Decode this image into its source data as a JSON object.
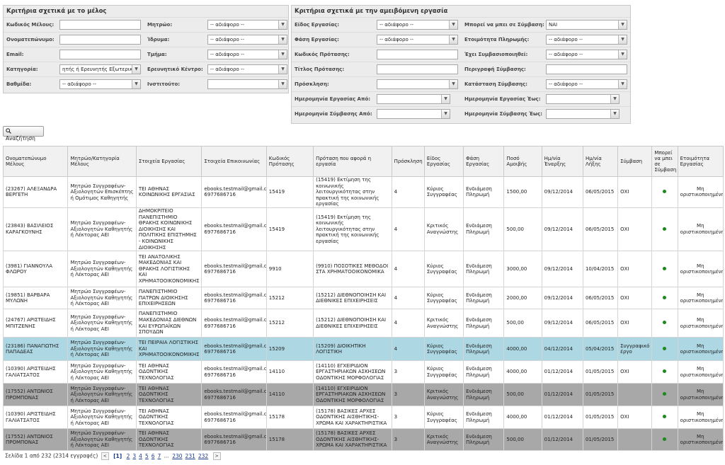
{
  "left_panel": {
    "title": "Κριτήρια σχετικά με το μέλος",
    "fields": [
      {
        "label": "Κωδικός Μέλους:",
        "type": "input",
        "value": ""
      },
      {
        "label": "Μητρώο:",
        "type": "select",
        "value": "-- αδιάφορο --"
      },
      {
        "label": "Ονοματεπώνυμο:",
        "type": "input",
        "value": ""
      },
      {
        "label": "Ίδρυμα:",
        "type": "select",
        "value": "-- αδιάφορο --"
      },
      {
        "label": "Email:",
        "type": "input",
        "value": ""
      },
      {
        "label": "Τμήμα:",
        "type": "select",
        "value": "-- αδιάφορο --"
      },
      {
        "label": "Κατηγορία:",
        "type": "select",
        "value": "ητής ή Ερευνητής Εξωτερικου"
      },
      {
        "label": "Ερευνητικό Κέντρο:",
        "type": "select",
        "value": "-- αδιάφορο --"
      },
      {
        "label": "Βαθμίδα:",
        "type": "select",
        "value": "-- αδιάφορο --"
      },
      {
        "label": "Ινστιτούτο:",
        "type": "select",
        "value": ""
      }
    ]
  },
  "right_panel": {
    "title": "Κριτήρια σχετικά με την αμειβόμενη εργασία",
    "fields": [
      {
        "label": "Είδος Εργασίας:",
        "type": "select",
        "value": "-- αδιάφορο --"
      },
      {
        "label": "Μπορεί να μπει σε Σύμβαση:",
        "type": "select",
        "value": "ΝΑΙ"
      },
      {
        "label": "Φάση Εργασίας:",
        "type": "select",
        "value": "-- αδιάφορο --"
      },
      {
        "label": "Ετοιμότητα Πληρωμής:",
        "type": "select",
        "value": "-- αδιάφορο --"
      },
      {
        "label": "Κωδικός Πρότασης:",
        "type": "input",
        "value": ""
      },
      {
        "label": "Έχει Συμβασιοποιηθεί:",
        "type": "select",
        "value": "-- αδιάφορο --"
      },
      {
        "label": "Τίτλος Πρότασης:",
        "type": "input",
        "value": ""
      },
      {
        "label": "Περιγραφή Σύμβασης:",
        "type": "input",
        "value": ""
      },
      {
        "label": "Πρόσκληση:",
        "type": "select",
        "value": ""
      },
      {
        "label": "Κατάσταση Σύμβασης:",
        "type": "select",
        "value": "-- αδιάφορο --"
      },
      {
        "label": "Ημερομηνία Εργασίας Από:",
        "type": "select",
        "value": ""
      },
      {
        "label": "Ημερομηνία Εργασίας Έως:",
        "type": "select",
        "value": ""
      },
      {
        "label": "Ημερομηνία Σύμβασης Από:",
        "type": "select",
        "value": ""
      },
      {
        "label": "Ημερομηνία Σύμβασης Έως:",
        "type": "select",
        "value": ""
      }
    ]
  },
  "search_button": {
    "label": "Αναζήτηση",
    "icon": "magnifier-icon"
  },
  "table": {
    "columns": [
      "Ονοματεπώνυμο Μέλους",
      "Μητρώο/Κατηγορία Μέλους",
      "Στοιχεία Εργασίας",
      "Στοιχεία Επικοινωνίας",
      "Κωδικός Πρότασης",
      "Πρόταση που αφορά η εργασία",
      "Πρόσκληση",
      "Είδος Εργασίας",
      "Φάση Εργασίας",
      "Ποσό Αμοιβής",
      "Ημ/νία Έναρξης",
      "Ημ/νία Λήξης",
      "Σύμβαση",
      "Μπορεί να μπει σε Σύμβαση",
      "Ετοιμότητα Εργασίας"
    ],
    "rows": [
      {
        "style": "white",
        "cells": [
          "(23267) ΑΛΕΞΑΝΔΡΑ ΒΕΡΓΕΤΗ",
          "Μητρώο Συγγραφέων-Αξιολογητών Επισκέπτης ή Ομότιμος Καθηγητής",
          "ΤΕΙ ΑΘΗΝΑΣ ΚΟΙΝΩΝΙΚΗΣ ΕΡΓΑΣΙΑΣ",
          "ebooks.testmail@gmail.com 6977686716",
          "15419",
          "(15419) Εκτίμηση της κοινωνικής λειτουργικότητας στην πρακτική της κοινωνικής εργασίας",
          "4",
          "Κύριος Συγγραφέας",
          "Ενδιάμεση Πληρωμή",
          "1500,00",
          "09/12/2014",
          "06/05/2015",
          "ΟΧΙ",
          "●",
          "Μη οριστικοποιημένη"
        ]
      },
      {
        "style": "white",
        "cells": [
          "(23843) ΒΑΣΙΛΕΙΟΣ ΚΑΡΑΓΚΟΥΝΗΣ",
          "Μητρώο Συγγραφέων-Αξιολογητών Καθηγητής ή Λέκτορας ΑΕΙ",
          "ΔΗΜΟΚΡΙΤΕΙΟ ΠΑΝΕΠΙΣΤΗΜΙΟ ΘΡΑΚΗΣ ΚΟΙΝΩΝΙΚΗΣ ΔΙΟΙΚΗΣΗΣ ΚΑΙ ΠΟΛΙΤΙΚΗΣ ΕΠΙΣΤΗΜΗΣ - ΚΟΙΝΩΝΙΚΗΣ ΔΙΟΙΚΗΣΗΣ",
          "ebooks.testmail@gmail.com 6977686716",
          "15419",
          "(15419) Εκτίμηση της κοινωνικής λειτουργικότητας στην πρακτική της κοινωνικής εργασίας",
          "4",
          "Κριτικός Αναγνώστης",
          "Ενδιάμεση Πληρωμή",
          "500,00",
          "09/12/2014",
          "06/05/2015",
          "ΟΧΙ",
          "●",
          "Μη οριστικοποιημένη"
        ]
      },
      {
        "style": "white",
        "cells": [
          "(3981) ΓΙΑΝΝΟΥΛΑ ΦΛΩΡΟΥ",
          "Μητρώο Συγγραφέων-Αξιολογητών Καθηγητής ή Λέκτορας ΑΕΙ",
          "ΤΕΙ ΑΝΑΤΟΛΙΚΗΣ ΜΑΚΕΔΟΝΙΑΣ ΚΑΙ ΘΡΑΚΗΣ ΛΟΓΙΣΤΙΚΗΣ ΚΑΙ ΧΡΗΜΑΤΟΟΙΚΟΝΟΜΙΚΗΣ",
          "ebooks.testmail@gmail.com 6977686716",
          "9910",
          "(9910) ΠΟΣΟΤΙΚΕΣ ΜΕΘΟΔΟΙ ΣΤΑ ΧΡΗΜΑΤΟΟΙΚΟΝΟΜΙΚΑ",
          "4",
          "Κύριος Συγγραφέας",
          "Ενδιάμεση Πληρωμή",
          "3000,00",
          "09/12/2014",
          "10/04/2015",
          "ΟΧΙ",
          "●",
          "Μη οριστικοποιημένη"
        ]
      },
      {
        "style": "white",
        "cells": [
          "(19851) ΒΑΡΒΑΡΑ ΜΥΛΩΝΗ",
          "Μητρώο Συγγραφέων-Αξιολογητών Καθηγητής ή Λέκτορας ΑΕΙ",
          "ΠΑΝΕΠΙΣΤΗΜΙΟ ΠΑΤΡΩΝ ΔΙΟΙΚΗΣΗΣ ΕΠΙΧΕΙΡΗΣΕΩΝ",
          "ebooks.testmail@gmail.com 6977686716",
          "15212",
          "(15212) ΔΙΕΘΝΟΠΟΙΗΣΗ ΚΑΙ ΔΙΕΘΝΙΚΕΣ ΕΠΙΧΕΙΡΗΣΕΙΣ",
          "4",
          "Κύριος Συγγραφέας",
          "Ενδιάμεση Πληρωμή",
          "2000,00",
          "09/12/2014",
          "06/05/2015",
          "ΟΧΙ",
          "●",
          "Μη οριστικοποιημένη"
        ]
      },
      {
        "style": "white",
        "cells": [
          "(24767) ΑΡΙΣΤΕΙΔΗΣ ΜΠΙΤΖΕΝΗΣ",
          "Μητρώο Συγγραφέων-Αξιολογητών Καθηγητής ή Λέκτορας ΑΕΙ",
          "ΠΑΝΕΠΙΣΤΗΜΙΟ ΜΑΚΕΔΟΝΙΑΣ ΔΙΕΘΝΩΝ ΚΑΙ ΕΥΡΩΠΑΪΚΩΝ ΣΠΟΥΔΩΝ",
          "ebooks.testmail@gmail.com 6977686716",
          "15212",
          "(15212) ΔΙΕΘΝΟΠΟΙΗΣΗ ΚΑΙ ΔΙΕΘΝΙΚΕΣ ΕΠΙΧΕΙΡΗΣΕΙΣ",
          "4",
          "Κριτικός Αναγνώστης",
          "Ενδιάμεση Πληρωμή",
          "500,00",
          "09/12/2014",
          "06/05/2015",
          "ΟΧΙ",
          "●",
          "Μη οριστικοποιημένη"
        ]
      },
      {
        "style": "sel",
        "cells": [
          "(23186) ΠΑΝΑΓΙΩΤΗΣ ΠΑΠΑΔΕΑΣ",
          "Μητρώο Συγγραφέων-Αξιολογητών Καθηγητής ή Λέκτορας ΑΕΙ",
          "ΤΕΙ ΠΕΙΡΑΙΑ ΛΟΓΙΣΤΙΚΗΣ ΚΑΙ ΧΡΗΜΑΤΟΟΙΚΟΝΟΜΙΚΗΣ",
          "ebooks.testmail@gmail.com 6977686716",
          "15209",
          "(15209) ΔΙΟΙΚΗΤΙΚΗ ΛΟΓΙΣΤΙΚΗ",
          "4",
          "Κύριος Συγγραφέας",
          "Ενδιάμεση Πληρωμή",
          "4000,00",
          "04/12/2014",
          "05/04/2015",
          "Συγγραφικό έργο",
          "●",
          "Μη οριστικοποιημένη"
        ]
      },
      {
        "style": "white",
        "cells": [
          "(10390) ΑΡΙΣΤΕΙΔΗΣ ΓΑΛΙΑΤΣΑΤΟΣ",
          "Μητρώο Συγγραφέων-Αξιολογητών Καθηγητής ή Λέκτορας ΑΕΙ",
          "ΤΕΙ ΑΘΗΝΑΣ ΟΔΟΝΤΙΚΗΣ ΤΕΧΝΟΛΟΓΙΑΣ",
          "ebooks.testmail@gmail.com 6977686716",
          "14110",
          "(14110) ΕΓΧΕΙΡΙΔΙΟΝ ΕΡΓΑΣΤΗΡΙΑΚΩΝ ΑΣΚΗΣΕΩΝ ΟΔΟΝΤΙΚΗΣ ΜΟΡΦΟΛΟΓΙΑΣ",
          "3",
          "Κύριος Συγγραφέας",
          "Ενδιάμεση Πληρωμή",
          "4000,00",
          "01/12/2014",
          "01/05/2015",
          "ΟΧΙ",
          "●",
          "Μη οριστικοποιημένη"
        ]
      },
      {
        "style": "gray",
        "cells": [
          "(17552) ΑΝΤΩΝΙΟΣ ΠΡΟΜΠΟΝΑΣ",
          "Μητρώο Συγγραφέων-Αξιολογητών Καθηγητής ή Λέκτορας ΑΕΙ",
          "ΤΕΙ ΑΘΗΝΑΣ ΟΔΟΝΤΙΚΗΣ ΤΕΧΝΟΛΟΓΙΑΣ",
          "ebooks.testmail@gmail.com 6977686716",
          "14110",
          "(14110) ΕΓΧΕΙΡΙΔΙΟΝ ΕΡΓΑΣΤΗΡΙΑΚΩΝ ΑΣΚΗΣΕΩΝ ΟΔΟΝΤΙΚΗΣ ΜΟΡΦΟΛΟΓΙΑΣ",
          "3",
          "Κριτικός Αναγνώστης",
          "Ενδιάμεση Πληρωμή",
          "500,00",
          "01/12/2014",
          "01/05/2015",
          "",
          "●",
          "Μη οριστικοποιημένη"
        ]
      },
      {
        "style": "white",
        "cells": [
          "(10390) ΑΡΙΣΤΕΙΔΗΣ ΓΑΛΙΑΤΣΑΤΟΣ",
          "Μητρώο Συγγραφέων-Αξιολογητών Καθηγητής ή Λέκτορας ΑΕΙ",
          "ΤΕΙ ΑΘΗΝΑΣ ΟΔΟΝΤΙΚΗΣ ΤΕΧΝΟΛΟΓΙΑΣ",
          "ebooks.testmail@gmail.com 6977686716",
          "15178",
          "(15178) ΒΑΣΙΚΕΣ ΑΡΧΕΣ ΟΔΟΝΤΙΚΗΣ ΑΙΣΘΗΤΙΚΗΣ-ΧΡΩΜΑ ΚΑΙ ΧΑΡΑΚΤΗΡΙΣΤΙΚΑ",
          "3",
          "Κύριος Συγγραφέας",
          "Ενδιάμεση Πληρωμή",
          "4000,00",
          "01/12/2014",
          "01/05/2015",
          "ΟΧΙ",
          "●",
          "Μη οριστικοποιημένη"
        ]
      },
      {
        "style": "gray",
        "cells": [
          "(17552) ΑΝΤΩΝΙΟΣ ΠΡΟΜΠΟΝΑΣ",
          "Μητρώο Συγγραφέων-Αξιολογητών Καθηγητής ή Λέκτορας ΑΕΙ",
          "ΤΕΙ ΑΘΗΝΑΣ ΟΔΟΝΤΙΚΗΣ ΤΕΧΝΟΛΟΓΙΑΣ",
          "ebooks.testmail@gmail.com 6977686716",
          "15178",
          "(15178) ΒΑΣΙΚΕΣ ΑΡΧΕΣ ΟΔΟΝΤΙΚΗΣ ΑΙΣΘΗΤΙΚΗΣ-ΧΡΩΜΑ ΚΑΙ ΧΑΡΑΚΤΗΡΙΣΤΙΚΑ",
          "3",
          "Κριτικός Αναγνώστης",
          "Ενδιάμεση Πληρωμή",
          "500,00",
          "01/12/2014",
          "01/05/2015",
          "",
          "●",
          "Μη οριστικοποιημένη"
        ]
      }
    ]
  },
  "pager": {
    "summary": "Σελίδα 1 από 232 (2314 εγγραφές)",
    "prev": "<",
    "current": "[1]",
    "pages": [
      "2",
      "3",
      "4",
      "5",
      "6",
      "7"
    ],
    "ellipsis": "...",
    "last_pages": [
      "230",
      "231",
      "232"
    ],
    "next": ">"
  },
  "colors": {
    "selected_row": "#acd7e3",
    "gray_row": "#a8a8a8",
    "status_dot": "#1a8a1a",
    "panel_bg": "#ececec"
  }
}
